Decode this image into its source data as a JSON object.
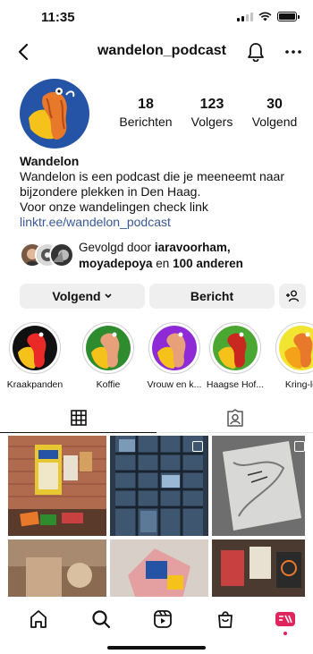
{
  "status_bar": {
    "time": "11:35"
  },
  "header": {
    "username": "wandelon_podcast"
  },
  "profile": {
    "stats": [
      {
        "value": "18",
        "label": "Berichten"
      },
      {
        "value": "123",
        "label": "Volgers"
      },
      {
        "value": "30",
        "label": "Volgend"
      }
    ],
    "name": "Wandelon",
    "bio_lines": [
      "Wandelon is een podcast die je meeneemt naar",
      "bijzondere plekken in Den Haag.",
      "Voor onze wandelingen check link"
    ],
    "link": "linktr.ee/wandelon_podcast"
  },
  "followed_by": {
    "prefix": "Gevolgd door ",
    "user1": "iaravoorham,",
    "user2": "moyadepoya",
    "middle": " en ",
    "rest": "100 anderen"
  },
  "actions": {
    "follow_label": "Volgend",
    "message_label": "Bericht"
  },
  "highlights": [
    {
      "label": "Kraakpanden",
      "color": "#ea2a26"
    },
    {
      "label": "Koffie",
      "color": "#2e8b2e"
    },
    {
      "label": "Vrouw en k...",
      "color": "#8e2ad6"
    },
    {
      "label": "Haagse Hof...",
      "color": "#4aa832"
    },
    {
      "label": "Kring-lo",
      "color": "#f2e531"
    }
  ],
  "colors": {
    "brand_blue": "#2553a6",
    "brand_yellow": "#f4c21a",
    "brand_orange": "#e8782a",
    "link": "#385898",
    "notification": "#e0245e"
  },
  "icons": {
    "back": "chevron-left-icon",
    "notifications": "bell-icon",
    "more": "more-horizontal-icon",
    "add_user": "add-person-icon",
    "grid": "grid-icon",
    "tagged": "tagged-person-icon",
    "home": "home-icon",
    "search": "search-icon",
    "reels": "reels-icon",
    "shop": "shop-bag-icon",
    "profile": "profile-avatar-icon"
  }
}
